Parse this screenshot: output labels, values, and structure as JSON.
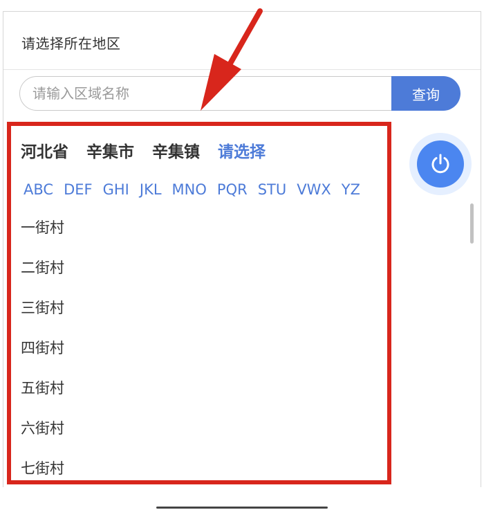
{
  "dialog": {
    "title": "请选择所在地区"
  },
  "search": {
    "placeholder": "请输入区域名称",
    "button_label": "查询"
  },
  "breadcrumb": {
    "province": "河北省",
    "city": "辛集市",
    "town": "辛集镇",
    "select_prompt": "请选择"
  },
  "alpha_tabs": [
    "ABC",
    "DEF",
    "GHI",
    "JKL",
    "MNO",
    "PQR",
    "STU",
    "VWX",
    "YZ"
  ],
  "villages": [
    "一街村",
    "二街村",
    "三街村",
    "四街村",
    "五街村",
    "六街村",
    "七街村"
  ],
  "icons": {
    "power": "power-icon",
    "annotation": "arrow-annotation"
  },
  "colors": {
    "accent": "#4d7bd8",
    "highlight_border": "#d8261c",
    "power_button": "#4b86f0"
  }
}
